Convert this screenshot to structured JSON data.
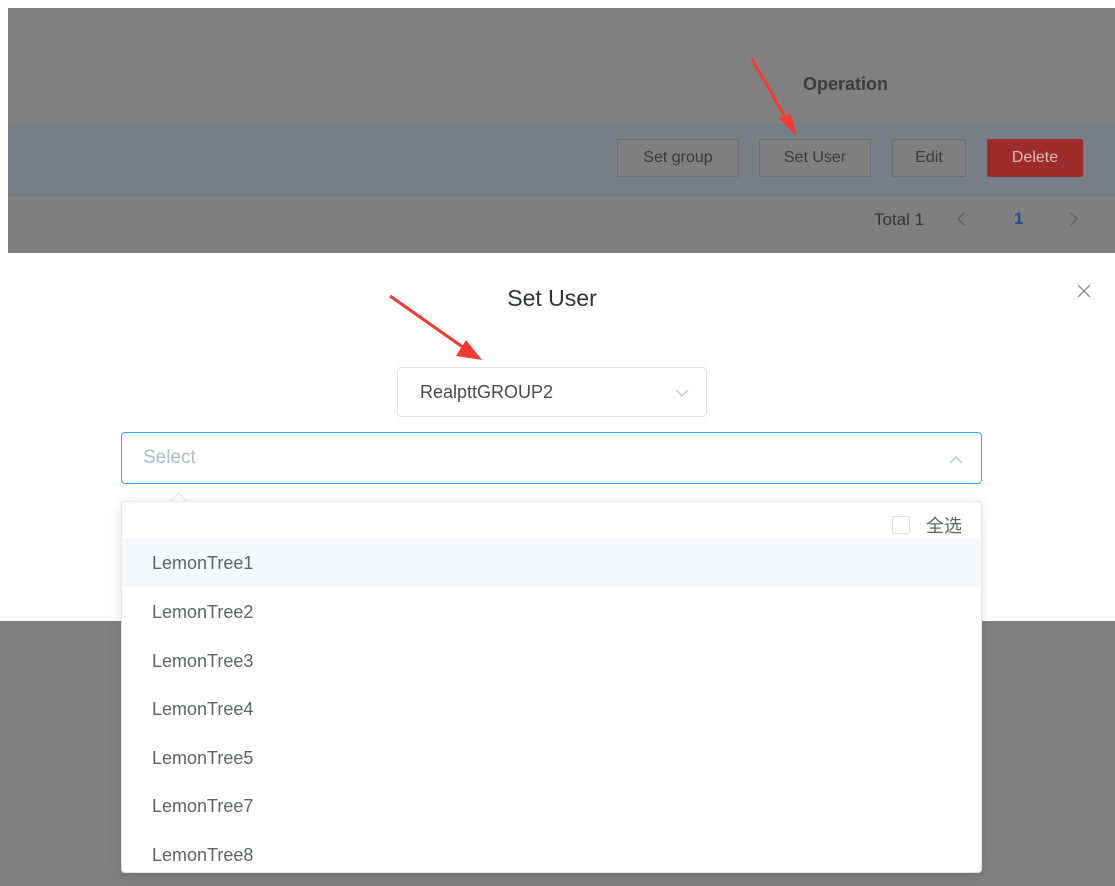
{
  "table": {
    "operation_header": "Operation",
    "buttons": {
      "set_group": "Set group",
      "set_user": "Set User",
      "edit": "Edit",
      "delete": "Delete"
    },
    "pagination": {
      "total": "Total 1",
      "current_page": "1",
      "prev_icon": "chevron-left-icon",
      "next_icon": "chevron-right-icon"
    }
  },
  "dialog": {
    "title": "Set User",
    "close_icon": "close-icon",
    "group_select": {
      "value": "RealpttGROUP2",
      "icon": "chevron-down-icon"
    },
    "user_select": {
      "placeholder": "Select",
      "icon": "chevron-up-icon"
    }
  },
  "dropdown": {
    "select_all_label": "全选",
    "options": [
      "LemonTree1",
      "LemonTree2",
      "LemonTree3",
      "LemonTree4",
      "LemonTree5",
      "LemonTree7",
      "LemonTree8"
    ],
    "hovered_option": "LemonTree1"
  },
  "colors": {
    "overlay": "#808080",
    "delete": "#a02b2b",
    "accent": "#409eff",
    "arrow": "#f03a32"
  }
}
